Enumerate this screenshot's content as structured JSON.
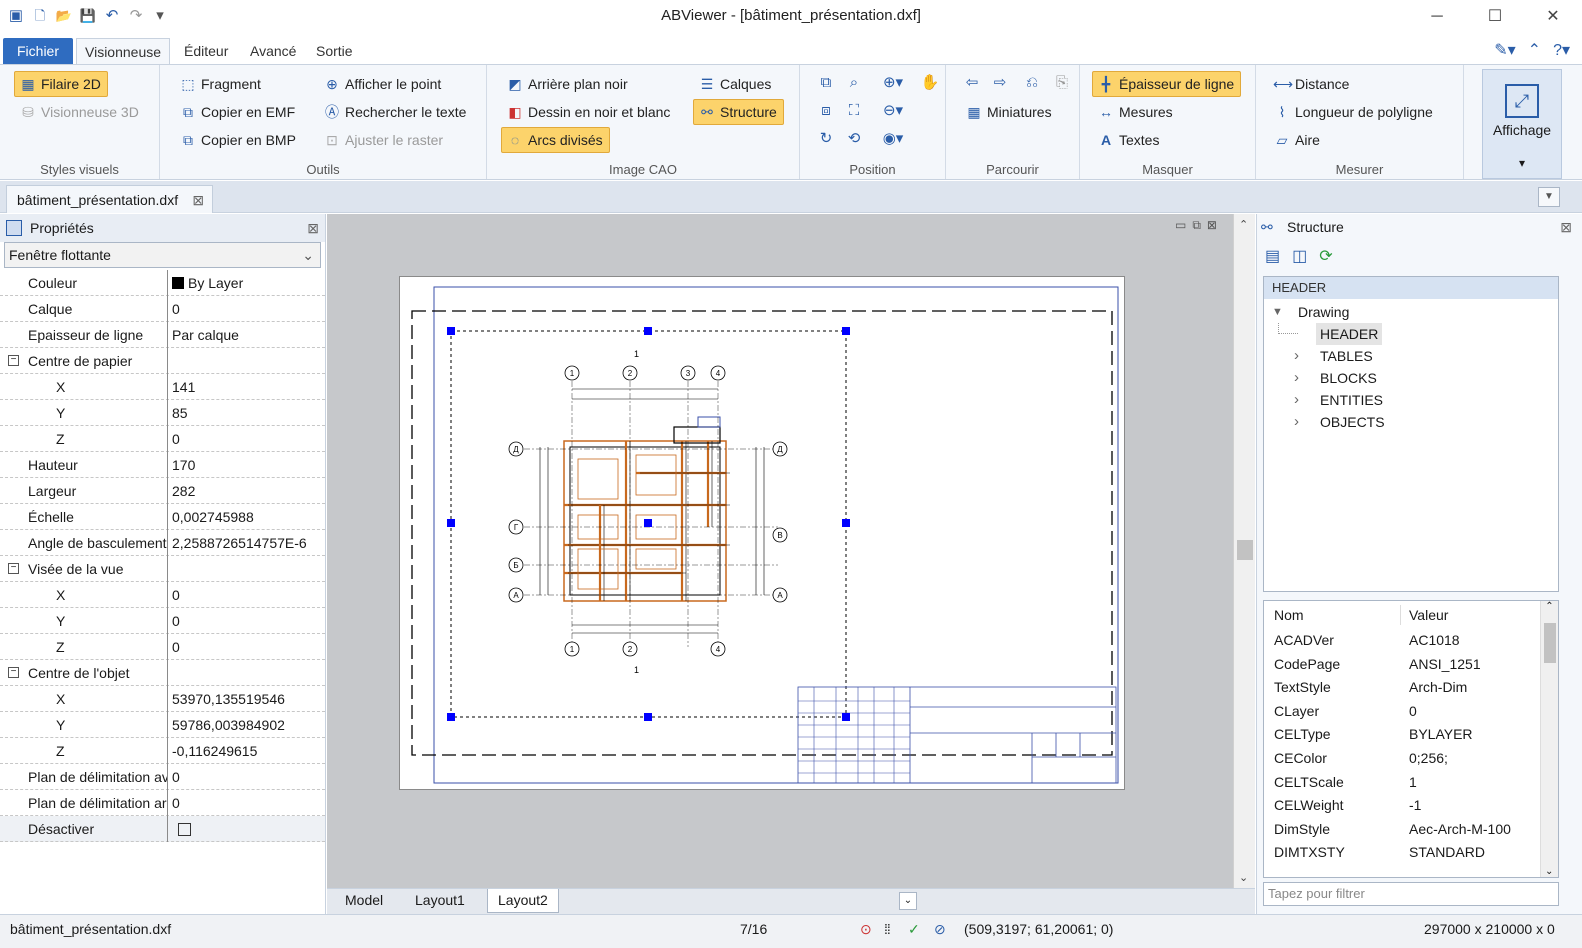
{
  "window": {
    "title": "ABViewer - [bâtiment_présentation.dxf]",
    "minimize_glyph": "─",
    "maximize_glyph": "☐",
    "close_glyph": "✕"
  },
  "quick_access": {
    "app_icon": "▣",
    "new": "🗋",
    "open": "📂",
    "save": "💾",
    "undo": "↶",
    "redo": "↷",
    "customize": "▾"
  },
  "ribbon_tabs": [
    "Fichier",
    "Visionneuse",
    "Éditeur",
    "Avancé",
    "Sortie"
  ],
  "ribbon_right": {
    "pen_icon": "✎▾",
    "up_icon": "⌃",
    "help_icon": "?▾"
  },
  "ribbon": {
    "styles_visuels": {
      "label": "Styles visuels",
      "filaire_2d": "Filaire 2D",
      "visionneuse_3d": "Visionneuse 3D"
    },
    "outils": {
      "label": "Outils",
      "fragment": "Fragment",
      "copier_emf": "Copier en EMF",
      "copier_bmp": "Copier en BMP",
      "afficher_point": "Afficher le point",
      "rechercher_texte": "Rechercher le texte",
      "ajuster_raster": "Ajuster le raster"
    },
    "image_cao": {
      "label": "Image CAO",
      "arriere_plan": "Arrière plan noir",
      "noir_blanc": "Dessin en noir et blanc",
      "arcs_divises": "Arcs divisés",
      "calques": "Calques",
      "structure": "Structure"
    },
    "position": {
      "label": "Position"
    },
    "parcourir": {
      "label": "Parcourir",
      "miniatures": "Miniatures"
    },
    "masquer": {
      "label": "Masquer",
      "epaisseur": "Épaisseur de ligne",
      "mesures": "Mesures",
      "textes": "Textes"
    },
    "mesurer": {
      "label": "Mesurer",
      "distance": "Distance",
      "longueur": "Longueur de polyligne",
      "aire": "Aire"
    },
    "affichage": {
      "label": "Affichage",
      "arrow": "▾"
    }
  },
  "document_tab": {
    "name": "bâtiment_présentation.dxf",
    "close": "⊠"
  },
  "properties": {
    "title": "Propriétés",
    "close": "⊠",
    "selector": "Fenêtre flottante",
    "rows": [
      {
        "key": "Couleur",
        "value": "By Layer",
        "type": "color"
      },
      {
        "key": "Calque",
        "value": "0"
      },
      {
        "key": "Epaisseur de ligne",
        "value": "Par calque"
      },
      {
        "key": "Centre de papier",
        "value": "",
        "type": "cat"
      },
      {
        "key": "X",
        "value": "141",
        "type": "sub"
      },
      {
        "key": "Y",
        "value": "85",
        "type": "sub"
      },
      {
        "key": "Z",
        "value": "0",
        "type": "sub"
      },
      {
        "key": "Hauteur",
        "value": "170"
      },
      {
        "key": "Largeur",
        "value": "282"
      },
      {
        "key": "Échelle",
        "value": "0,002745988"
      },
      {
        "key": "Angle de basculement",
        "value": "2,2588726514757E-6"
      },
      {
        "key": "Visée de la vue",
        "value": "",
        "type": "cat"
      },
      {
        "key": "X",
        "value": "0",
        "type": "sub"
      },
      {
        "key": "Y",
        "value": "0",
        "type": "sub"
      },
      {
        "key": "Z",
        "value": "0",
        "type": "sub"
      },
      {
        "key": "Centre de l'objet",
        "value": "",
        "type": "cat"
      },
      {
        "key": "X",
        "value": "53970,135519546",
        "type": "sub"
      },
      {
        "key": "Y",
        "value": "59786,003984902",
        "type": "sub"
      },
      {
        "key": "Z",
        "value": "-0,116249615",
        "type": "sub"
      },
      {
        "key": "Plan de délimitation avant",
        "value": "0"
      },
      {
        "key": "Plan de délimitation arrière",
        "value": "0"
      },
      {
        "key": "Désactiver",
        "value": "",
        "type": "check"
      }
    ]
  },
  "drawing": {
    "axis_top": [
      "1",
      "2",
      "3",
      "4"
    ],
    "axis_bottom": [
      "1",
      "2",
      "4"
    ],
    "axis_left": [
      "Д",
      "Г",
      "Б",
      "А"
    ],
    "axis_right": [
      "Д",
      "В",
      "А"
    ],
    "section_mark": "1"
  },
  "layout_tabs": [
    "Model",
    "Layout1",
    "Layout2"
  ],
  "structure": {
    "title": "Structure",
    "close": "⊠",
    "tree_header": "HEADER",
    "tree_root": "Drawing",
    "tree_children": [
      "HEADER",
      "TABLES",
      "BLOCKS",
      "ENTITIES",
      "OBJECTS"
    ],
    "table_headers": [
      "Nom",
      "Valeur"
    ],
    "table_rows": [
      [
        "ACADVer",
        "AC1018"
      ],
      [
        "CodePage",
        "ANSI_1251"
      ],
      [
        "TextStyle",
        "Arch-Dim"
      ],
      [
        "CLayer",
        "0"
      ],
      [
        "CELType",
        "BYLAYER"
      ],
      [
        "CEColor",
        "0;256;"
      ],
      [
        "CELTScale",
        "1"
      ],
      [
        "CELWeight",
        "-1"
      ],
      [
        "DimStyle",
        "Aec-Arch-M-100"
      ],
      [
        "DIMTXSTY",
        "STANDARD"
      ]
    ],
    "filter_placeholder": "Tapez pour filtrer"
  },
  "status": {
    "file": "bâtiment_présentation.dxf",
    "page": "7/16",
    "coords": "(509,3197; 61,20061; 0)",
    "size": "297000 x 210000 x 0"
  },
  "colors": {
    "accent": "#2f6cc0",
    "highlight": "#fcd36b",
    "grip": "#0000ff",
    "wall": "#c8691e"
  }
}
